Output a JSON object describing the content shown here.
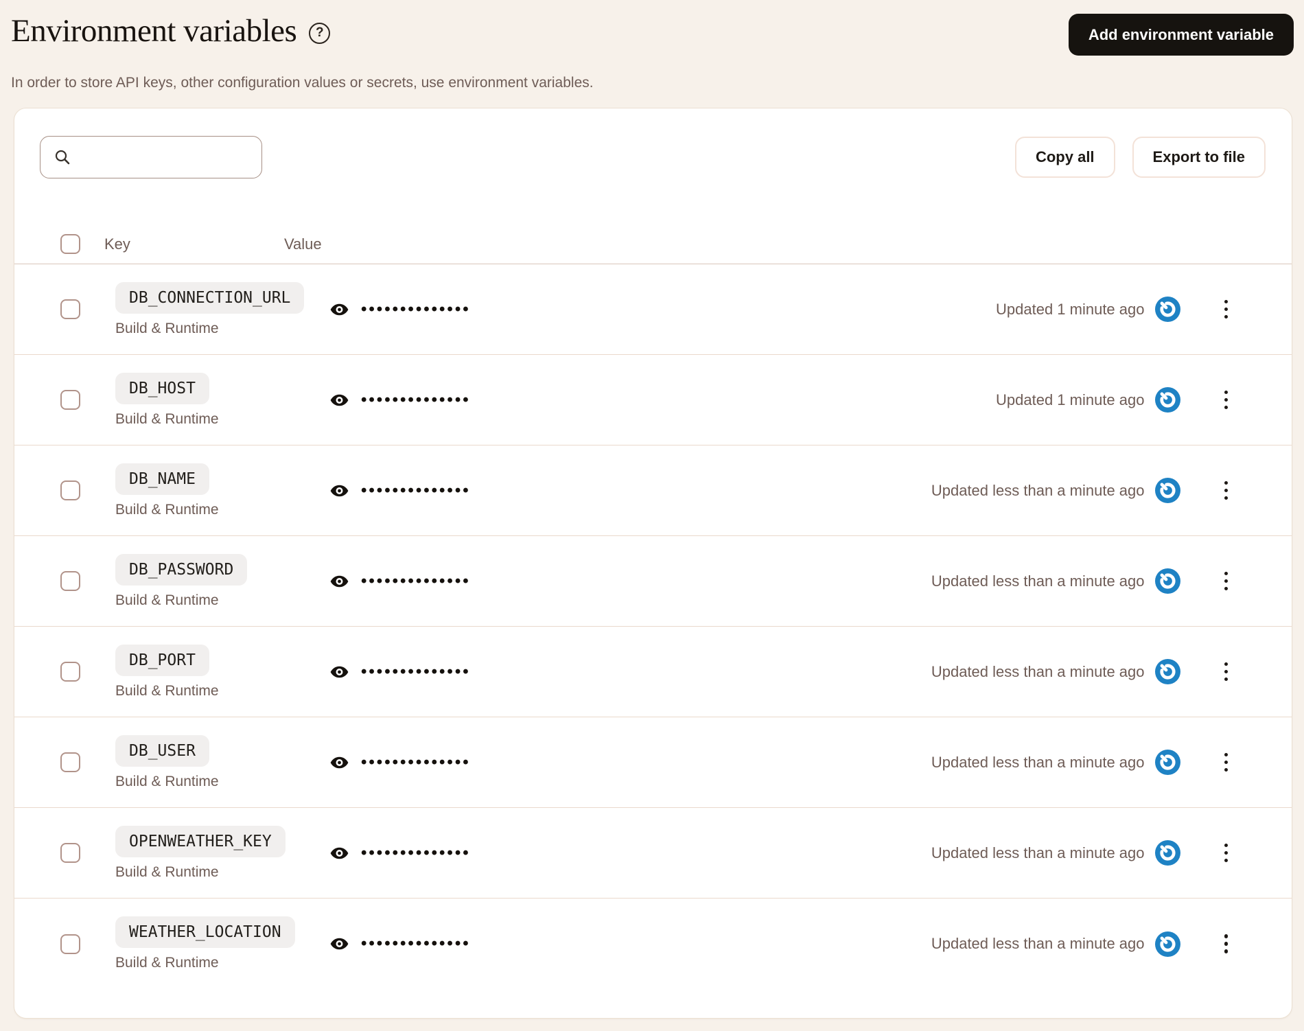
{
  "page": {
    "title": "Environment variables",
    "help_icon_glyph": "?",
    "subtitle": "In order to store API keys, other configuration values or secrets, use environment variables.",
    "add_button_label": "Add environment variable"
  },
  "toolbar": {
    "search_placeholder": "",
    "search_value": "",
    "copy_all_label": "Copy all",
    "export_label": "Export to file"
  },
  "table": {
    "columns": {
      "key": "Key",
      "value": "Value"
    },
    "masked_value": "••••••••••••••",
    "rows": [
      {
        "key": "DB_CONNECTION_URL",
        "scope": "Build & Runtime",
        "updated": "Updated 1 minute ago"
      },
      {
        "key": "DB_HOST",
        "scope": "Build & Runtime",
        "updated": "Updated 1 minute ago"
      },
      {
        "key": "DB_NAME",
        "scope": "Build & Runtime",
        "updated": "Updated less than a minute ago"
      },
      {
        "key": "DB_PASSWORD",
        "scope": "Build & Runtime",
        "updated": "Updated less than a minute ago"
      },
      {
        "key": "DB_PORT",
        "scope": "Build & Runtime",
        "updated": "Updated less than a minute ago"
      },
      {
        "key": "DB_USER",
        "scope": "Build & Runtime",
        "updated": "Updated less than a minute ago"
      },
      {
        "key": "OPENWEATHER_KEY",
        "scope": "Build & Runtime",
        "updated": "Updated less than a minute ago"
      },
      {
        "key": "WEATHER_LOCATION",
        "scope": "Build & Runtime",
        "updated": "Updated less than a minute ago"
      }
    ]
  },
  "icons": {
    "help": "question-mark-circle",
    "search": "magnifying-glass",
    "eye": "reveal-eye",
    "sync": "blue-sync-power-badge",
    "kebab": "vertical-ellipsis-menu"
  },
  "colors": {
    "page_background": "#f7f1ea",
    "card_background": "#ffffff",
    "card_border": "#ece0d2",
    "text_dark": "#1b1613",
    "text_muted": "#6e5c56",
    "divider": "#ead9cc",
    "checkbox_border": "#b1938a",
    "search_border": "#a68f85",
    "pill_background": "#f1efee",
    "primary_button_background": "#16130f",
    "ghost_button_border": "#f3e2d8",
    "sync_icon_blue": "#1e82c4"
  }
}
